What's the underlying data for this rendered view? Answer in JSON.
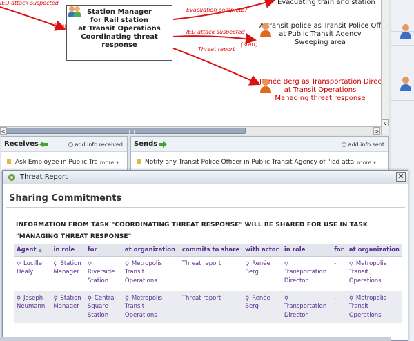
{
  "diagram": {
    "edge_labels": {
      "ied_left": "IED attack suspected",
      "start_left": "(start)",
      "evacuation": "Evacuation complete?",
      "ied_mid": "IED attack suspected",
      "start_mid": "(start)",
      "threat_report": "Threat report"
    },
    "focus_node": {
      "line1": "Station Manager",
      "line2": "for Rail station",
      "line3": "at Transit Operations",
      "line4": "Coordinating threat response"
    },
    "top_node": "Evacuating train and station",
    "police_node": {
      "line1": "A transit police as Transit Police Officer",
      "line2": "at Public Transit Agency",
      "line3": "Sweeping area"
    },
    "director_node": {
      "line1": "Renée Berg as Transportation Director",
      "line2": "at Transit Operations",
      "line3": "Managing threat response"
    }
  },
  "scroll": {
    "left_arrow": "<",
    "right_arrow": ">",
    "down_arrow": "v"
  },
  "receives": {
    "title": "Receives",
    "add_label": "add info received",
    "item": "Ask Employee in Public Transit",
    "more": "more ▾"
  },
  "sends": {
    "title": "Sends",
    "add_label": "add info sent",
    "item": "Notify any Transit Police Officer in Public Transit Agency of \"ied attack",
    "more": "more ▾"
  },
  "dialog": {
    "title": "Threat Report",
    "close": "✕",
    "heading": "Sharing Commitments",
    "info": "Information from task \"coordinating threat response\" will be shared for use in task \"managing threat response\"",
    "columns": [
      "Agent",
      "in role",
      "for",
      "at organization",
      "commits to share",
      "with actor",
      "in role",
      "for",
      "at organization"
    ],
    "rows": [
      {
        "agent": "Lucille Healy",
        "role": "Station Manager",
        "for": "Riverside Station",
        "org": "Metropolis Transit Operations",
        "info": "Threat report",
        "actor": "Renée Berg",
        "actor_role": "Transportation Director",
        "actor_for": "-",
        "actor_org": "Metropolis Transit Operations"
      },
      {
        "agent": "Joseph Neumann",
        "role": "Station Manager",
        "for": "Central Square Station",
        "org": "Metropolis Transit Operations",
        "info": "Threat report",
        "actor": "Renée Berg",
        "actor_role": "Transportation Director",
        "actor_for": "-",
        "actor_org": "Metropolis Transit Operations"
      }
    ]
  },
  "colors": {
    "edge": "#d11111",
    "table_text": "#5a2d91",
    "accent_green": "#3fa52f"
  },
  "icons": [
    "group-icon",
    "person-icon",
    "arrow-left-icon",
    "arrow-right-icon",
    "gear-icon",
    "close-icon",
    "link-icon"
  ]
}
